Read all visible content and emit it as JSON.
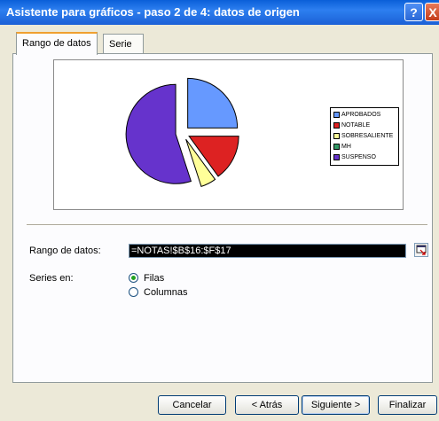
{
  "window": {
    "title": "Asistente para gráficos - paso 2 de 4: datos de origen",
    "help": "?",
    "close": "X"
  },
  "tabs": [
    {
      "label": "Rango de datos"
    },
    {
      "label": "Serie"
    }
  ],
  "legend": {
    "items": [
      {
        "label": "APROBADOS",
        "color": "#6699ff"
      },
      {
        "label": "NOTABLE",
        "color": "#dd2222"
      },
      {
        "label": "SOBRESALIENTE",
        "color": "#ffff99"
      },
      {
        "label": "MH",
        "color": "#339966"
      },
      {
        "label": "SUSPENSO",
        "color": "#6633cc"
      }
    ]
  },
  "chart_data": {
    "type": "pie",
    "categories": [
      "APROBADOS",
      "NOTABLE",
      "SOBRESALIENTE",
      "MH",
      "SUSPENSO"
    ],
    "values": [
      25,
      15,
      5,
      0,
      55
    ],
    "colors": [
      "#6699ff",
      "#dd2222",
      "#ffff99",
      "#339966",
      "#6633cc"
    ],
    "legend": "right",
    "exploded": true
  },
  "form": {
    "range_label": "Rango de datos:",
    "range_value": "=NOTAS!$B$16:$F$17",
    "series_label": "Series en:",
    "rows_label": "Filas",
    "cols_label": "Columnas"
  },
  "buttons": {
    "cancel": "Cancelar",
    "back": "< Atrás",
    "next": "Siguiente >",
    "finish": "Finalizar"
  }
}
